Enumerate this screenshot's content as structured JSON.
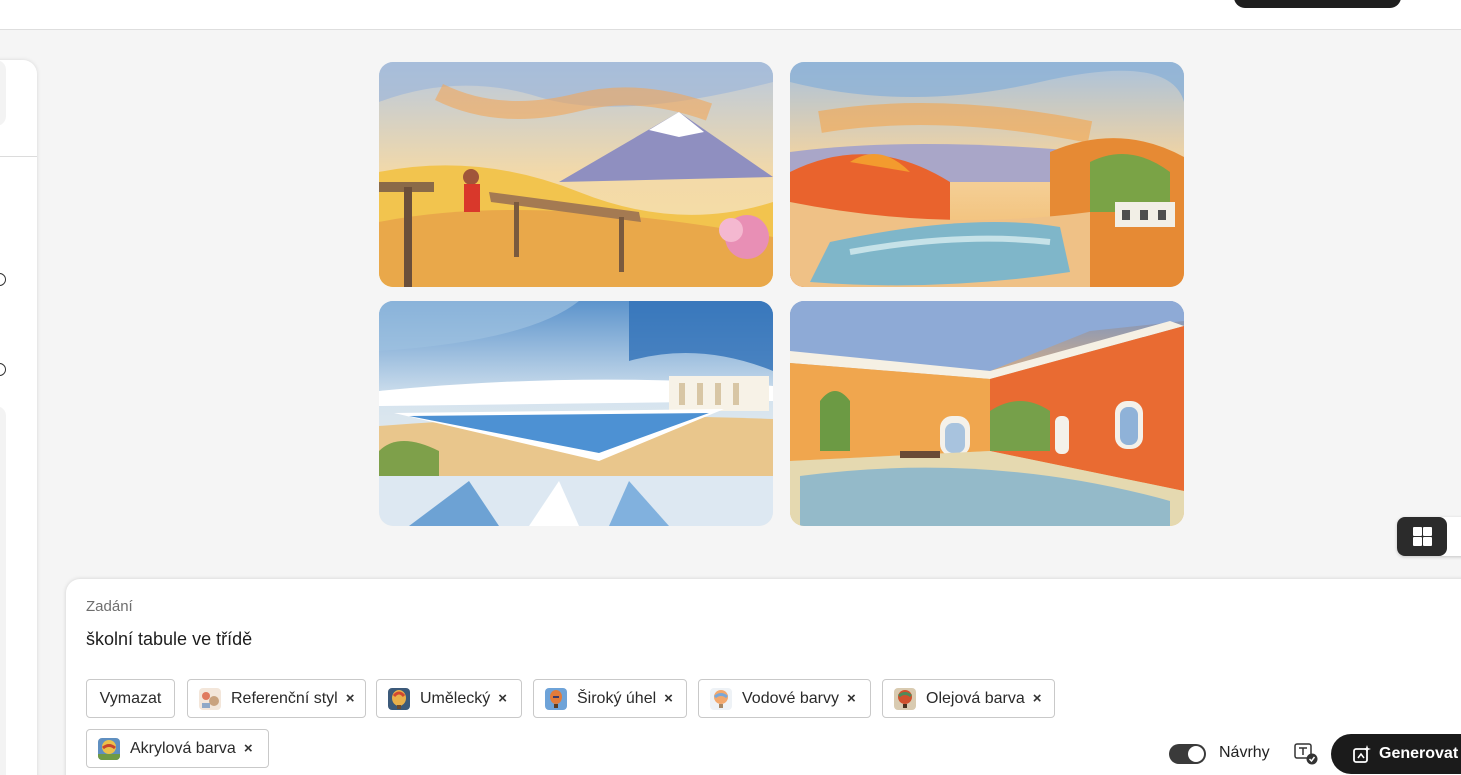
{
  "prompt": {
    "label": "Zadání",
    "text": "školní tabule ve třídě"
  },
  "chips": {
    "clear": "Vymazat",
    "items": [
      {
        "label": "Referenční styl",
        "icon": "reference-style-thumbnail"
      },
      {
        "label": "Umělecký",
        "icon": "artistic-thumbnail"
      },
      {
        "label": "Široký úhel",
        "icon": "wide-angle-thumbnail"
      },
      {
        "label": "Vodové barvy",
        "icon": "watercolor-thumbnail"
      },
      {
        "label": "Olejová barva",
        "icon": "oil-paint-thumbnail"
      },
      {
        "label": "Akrylová barva",
        "icon": "acrylic-paint-thumbnail"
      }
    ],
    "remove_glyph": "×"
  },
  "footer": {
    "suggestions_label": "Návrhy",
    "suggestions_on": true,
    "generate_label": "Generovat"
  },
  "gallery": {
    "images": [
      {
        "subject": "mountain-terrace-painting"
      },
      {
        "subject": "river-landscape-painting"
      },
      {
        "subject": "pool-sky-painting"
      },
      {
        "subject": "interior-hall-painting"
      }
    ]
  },
  "colors": {
    "accent_dark": "#1b1b1b",
    "panel_bg": "#ffffff",
    "page_bg": "#f5f5f5"
  }
}
